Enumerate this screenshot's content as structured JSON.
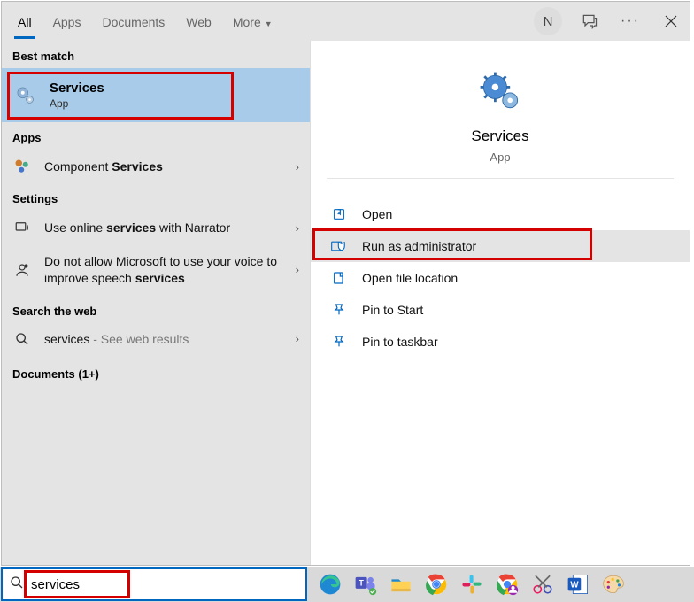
{
  "tabs": {
    "all": "All",
    "apps": "Apps",
    "documents": "Documents",
    "web": "Web",
    "more": "More"
  },
  "user_initial": "N",
  "sections": {
    "best": "Best match",
    "apps": "Apps",
    "settings": "Settings",
    "web": "Search the web",
    "documents": "Documents (1+)"
  },
  "best": {
    "title": "Services",
    "subtitle": "App"
  },
  "apps_row": {
    "prefix": "Component ",
    "bold": "Services"
  },
  "settings_rows": {
    "r1": {
      "prefix": "Use online ",
      "bold": "services",
      "suffix": " with Narrator"
    },
    "r2": {
      "prefix": "Do not allow Microsoft to use your voice to improve speech ",
      "bold": "services"
    }
  },
  "web_row": {
    "term": "services",
    "hint": " - See web results"
  },
  "right": {
    "title": "Services",
    "subtitle": "App"
  },
  "actions": {
    "open": "Open",
    "runadmin": "Run as administrator",
    "openloc": "Open file location",
    "pinstart": "Pin to Start",
    "pintask": "Pin to taskbar"
  },
  "search_value": "services"
}
